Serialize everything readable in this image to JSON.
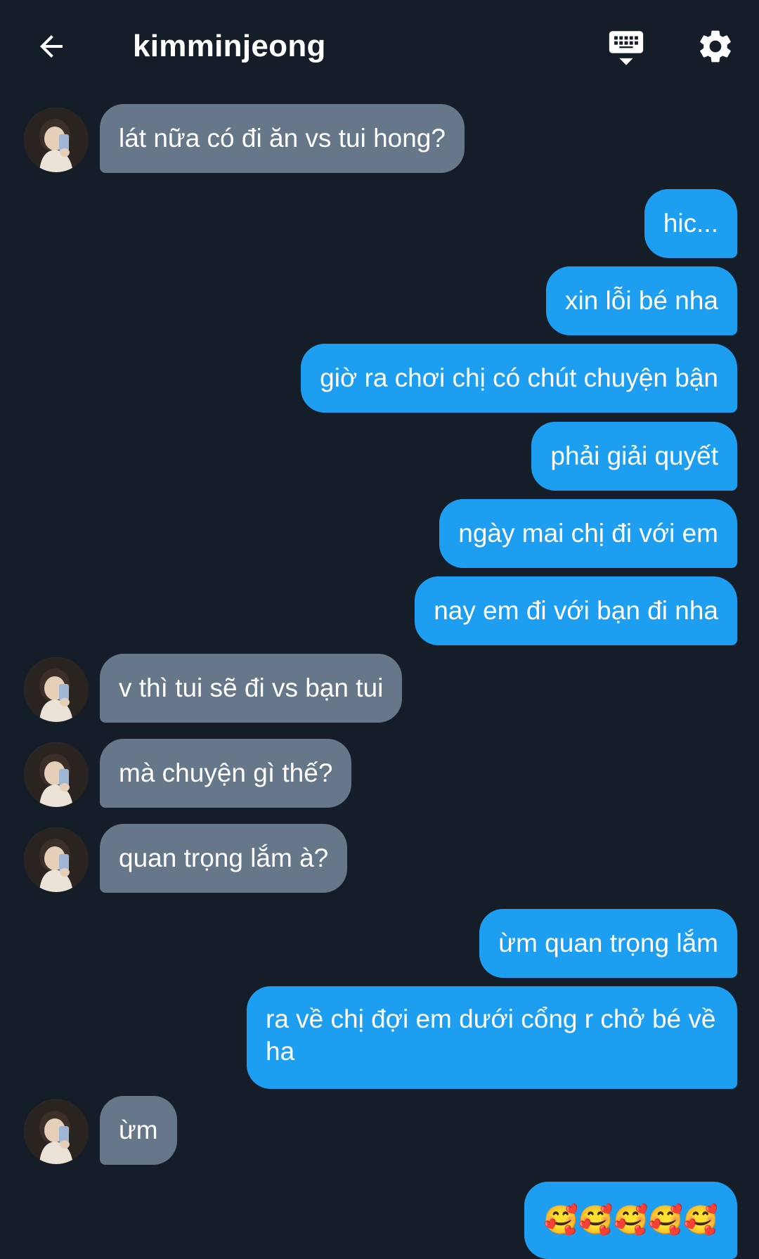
{
  "header": {
    "title": "kimminjeong",
    "back_icon": "arrow-left-icon",
    "keyboard_icon": "keyboard-icon",
    "settings_icon": "gear-icon"
  },
  "colors": {
    "background": "#151d28",
    "incoming_bubble": "#66778a",
    "outgoing_bubble": "#1e9ef0",
    "text": "#ffffff"
  },
  "messages": [
    {
      "side": "in",
      "text": "lát nữa có đi ăn vs tui hong?"
    },
    {
      "side": "out",
      "text": "hic..."
    },
    {
      "side": "out",
      "text": "xin lỗi bé nha"
    },
    {
      "side": "out",
      "text": "giờ ra chơi chị có chút chuyện bận"
    },
    {
      "side": "out",
      "text": "phải giải quyết"
    },
    {
      "side": "out",
      "text": "ngày mai chị đi với em"
    },
    {
      "side": "out",
      "text": "nay em đi với bạn đi nha"
    },
    {
      "side": "in",
      "text": "v thì tui sẽ đi vs bạn tui"
    },
    {
      "side": "in",
      "text": "mà chuyện gì thế?"
    },
    {
      "side": "in",
      "text": "quan trọng lắm à?"
    },
    {
      "side": "out",
      "text": "ừm quan trọng lắm"
    },
    {
      "side": "out",
      "text": "ra về chị đợi em dưới cổng r chở bé về ha"
    },
    {
      "side": "in",
      "text": "ừm"
    },
    {
      "side": "out",
      "text": "🥰🥰🥰🥰🥰",
      "emoji_name": "smiling-face-with-hearts-icon"
    }
  ]
}
